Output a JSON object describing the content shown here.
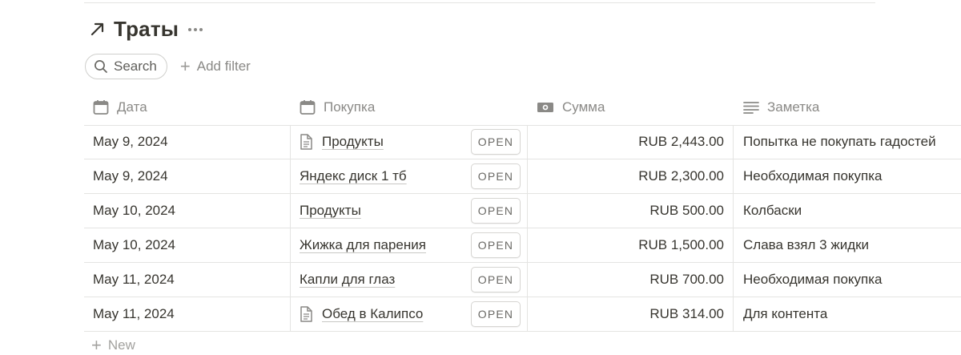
{
  "title": "Траты",
  "toolbar": {
    "search_label": "Search",
    "add_filter_label": "Add filter"
  },
  "columns": [
    {
      "label": "Дата",
      "icon": "calendar-icon"
    },
    {
      "label": "Покупка",
      "icon": "calendar-icon"
    },
    {
      "label": "Сумма",
      "icon": "money-icon"
    },
    {
      "label": "Заметка",
      "icon": "text-lines-icon"
    }
  ],
  "open_label": "OPEN",
  "rows": [
    {
      "date": "May 9, 2024",
      "purchase": "Продукты",
      "has_doc_icon": true,
      "amount": "RUB 2,443.00",
      "note": "Попытка не покупать гадостей"
    },
    {
      "date": "May 9, 2024",
      "purchase": "Яндекс диск 1 тб",
      "has_doc_icon": false,
      "amount": "RUB 2,300.00",
      "note": "Необходимая покупка"
    },
    {
      "date": "May 10, 2024",
      "purchase": "Продукты",
      "has_doc_icon": false,
      "amount": "RUB 500.00",
      "note": "Колбаски"
    },
    {
      "date": "May 10, 2024",
      "purchase": "Жижка для парения",
      "has_doc_icon": false,
      "amount": "RUB 1,500.00",
      "note": "Слава взял 3 жидки"
    },
    {
      "date": "May 11, 2024",
      "purchase": "Капли для глаз",
      "has_doc_icon": false,
      "amount": "RUB 700.00",
      "note": "Необходимая покупка"
    },
    {
      "date": "May 11, 2024",
      "purchase": "Обед в Калипсо",
      "has_doc_icon": true,
      "amount": "RUB 314.00",
      "note": "Для контента"
    }
  ],
  "new_row_label": "New"
}
